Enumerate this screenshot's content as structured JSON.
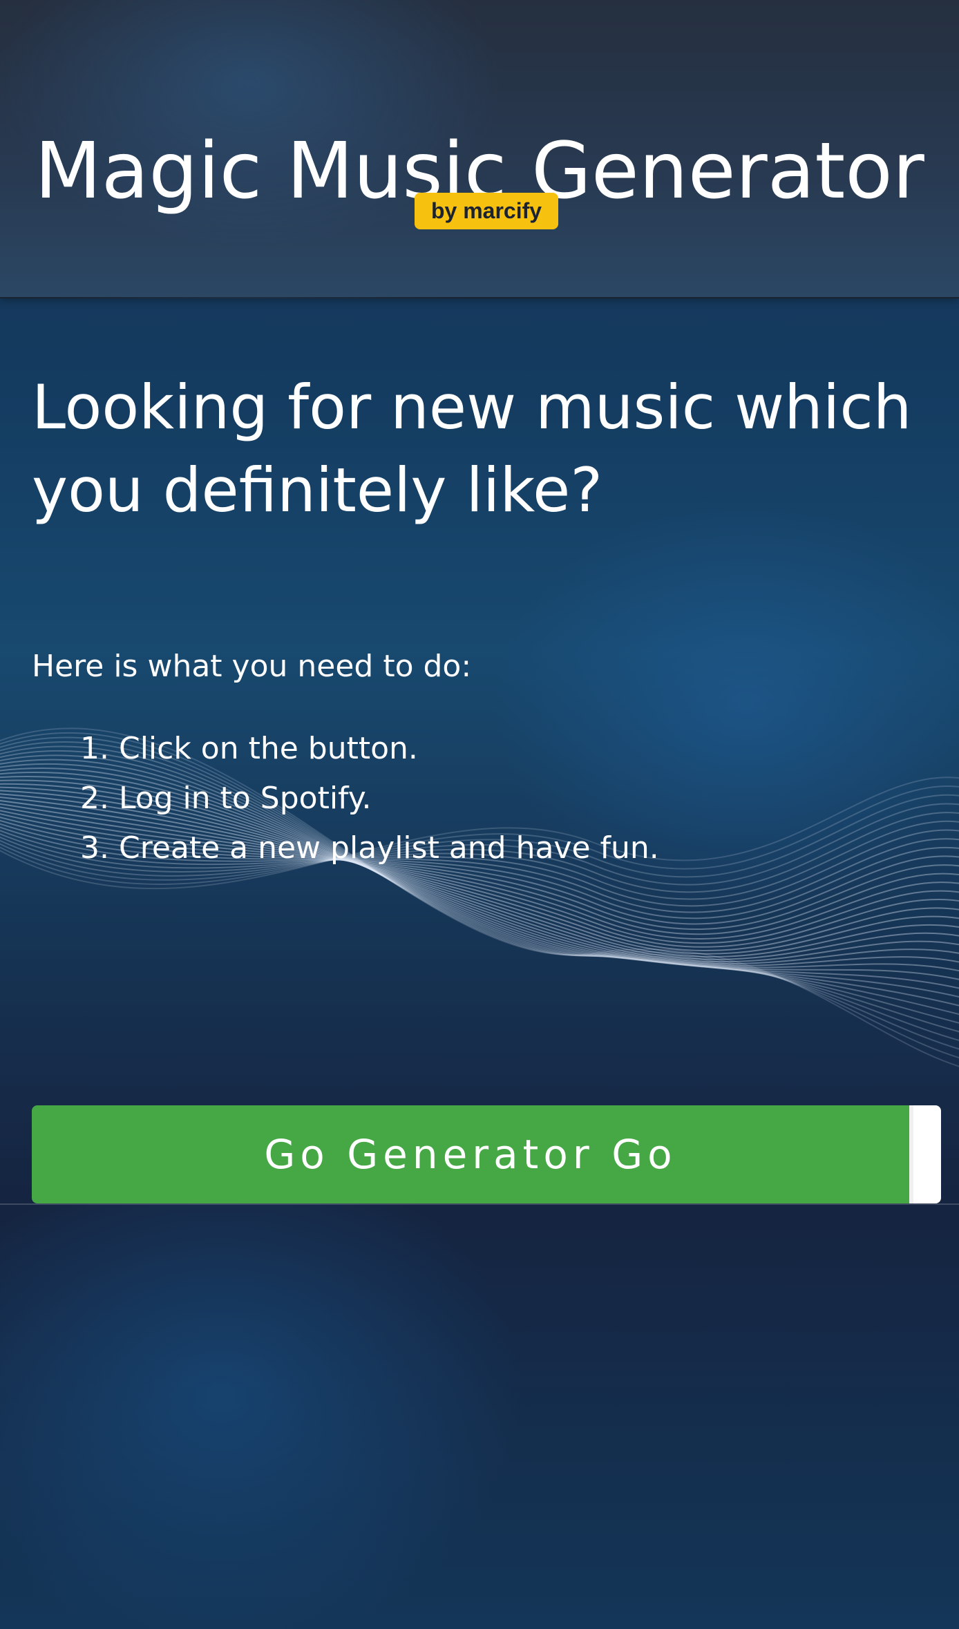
{
  "header": {
    "title": "Magic Music Generator",
    "badge": "by marcify"
  },
  "main": {
    "headline": "Looking for new music which you definitely like?",
    "intro": "Here is what you need to do:",
    "steps": [
      "1. Click on the button.",
      "2. Log in to Spotify.",
      "3. Create a new playlist and have fun."
    ],
    "button_label": "Go Generator Go"
  },
  "colors": {
    "badge_background": "#f7c20f",
    "button_background": "#45a845",
    "page_background": "#18496f",
    "header_background": "#283a52"
  },
  "icons": {
    "background_decoration": "wave-lines-icon"
  }
}
